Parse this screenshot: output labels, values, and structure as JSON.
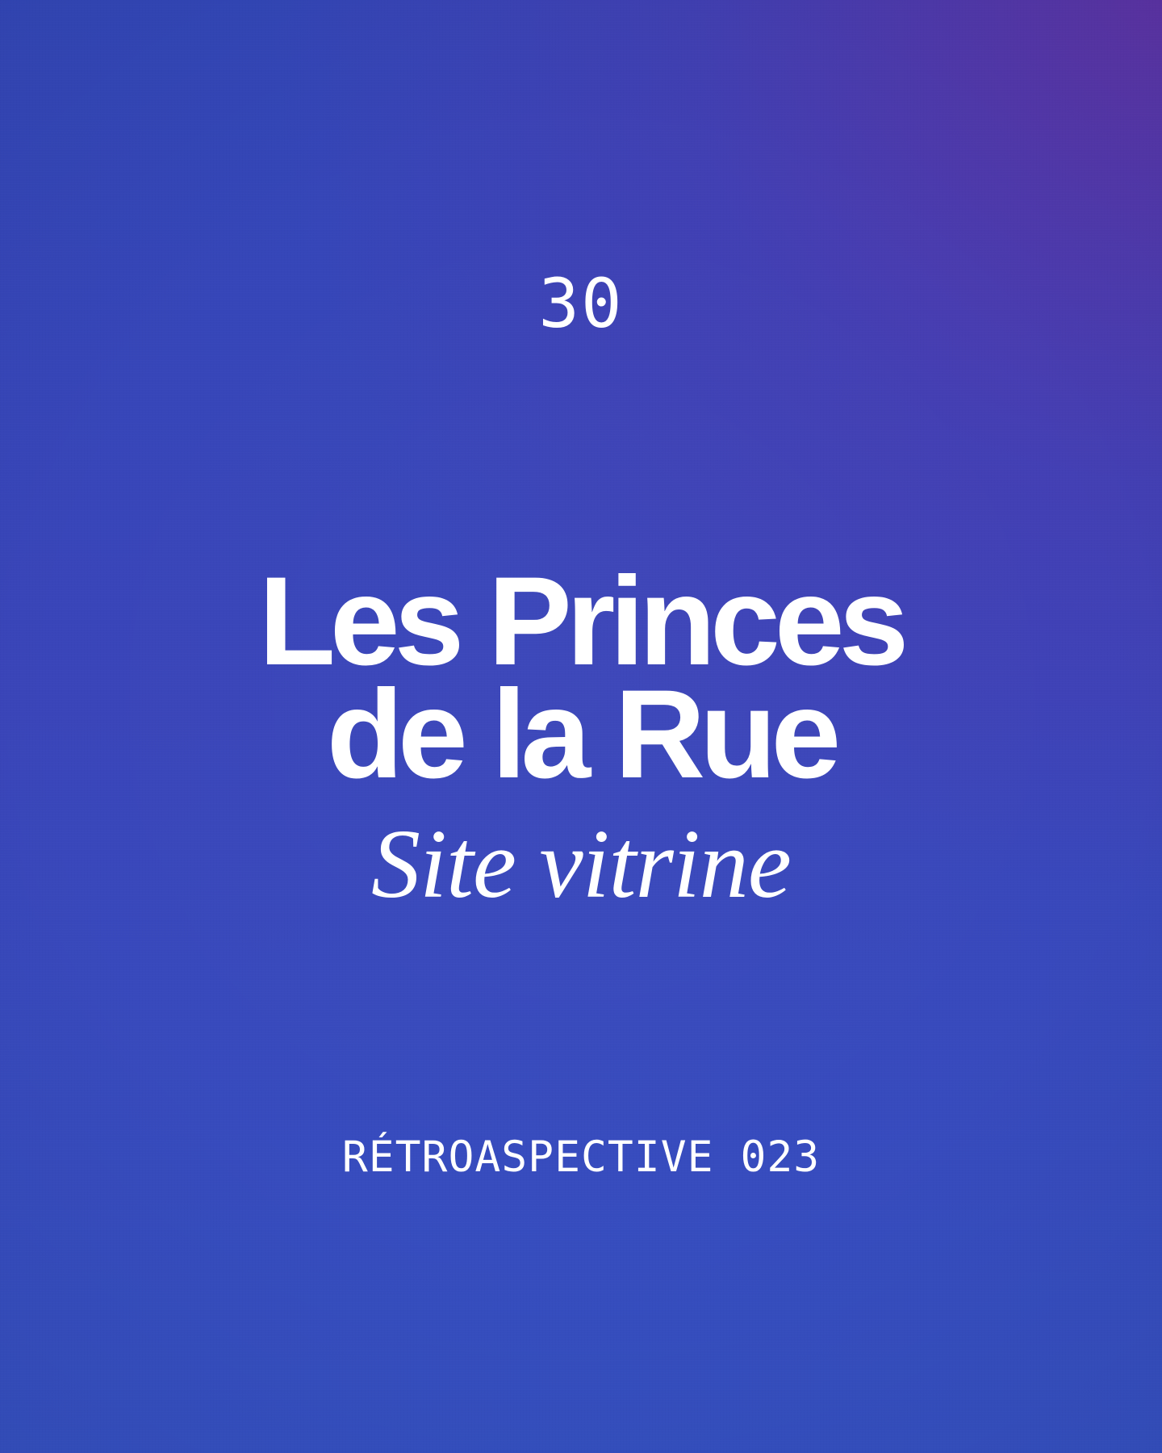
{
  "cover": {
    "number": "30",
    "title_line_1": "Les Princes",
    "title_line_2": "de la Rue",
    "subtitle": "Site vitrine",
    "footer": "RÉTROASPECTIVE 023"
  },
  "colors": {
    "background_main": "#3948bb",
    "background_corner_accent": "#6a2da0",
    "text": "#ffffff"
  }
}
